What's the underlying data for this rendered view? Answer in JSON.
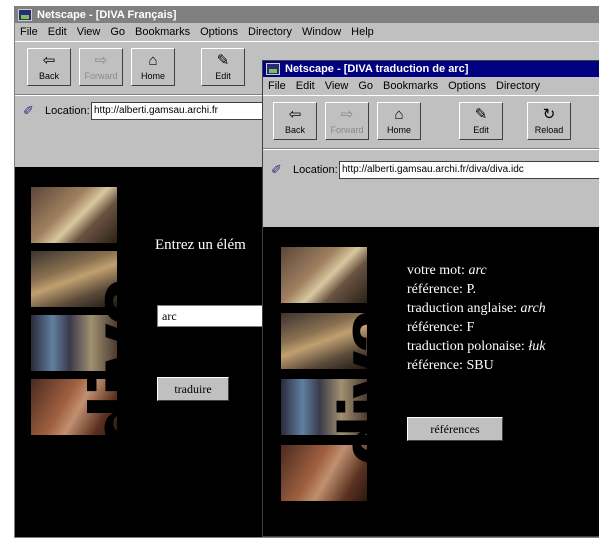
{
  "back_window": {
    "title": "Netscape - [DIVA Français]",
    "menu": [
      "File",
      "Edit",
      "View",
      "Go",
      "Bookmarks",
      "Options",
      "Directory",
      "Window",
      "Help"
    ],
    "toolbar": [
      {
        "label": "Back",
        "icon": "back-arrow-icon"
      },
      {
        "label": "Forward",
        "icon": "forward-arrow-icon"
      },
      {
        "label": "Home",
        "icon": "home-icon"
      },
      {
        "label": "Edit",
        "icon": "pencil-icon"
      }
    ],
    "location_label": "Location:",
    "location_url": "http://alberti.gamsau.archi.fr",
    "prompt": "Entrez un élém",
    "input_value": "arc",
    "button_label": "traduire"
  },
  "front_window": {
    "title": "Netscape - [DIVA traduction de arc]",
    "menu": [
      "File",
      "Edit",
      "View",
      "Go",
      "Bookmarks",
      "Options",
      "Directory"
    ],
    "toolbar": [
      {
        "label": "Back",
        "icon": "back-arrow-icon"
      },
      {
        "label": "Forward",
        "icon": "forward-arrow-icon"
      },
      {
        "label": "Home",
        "icon": "home-icon"
      },
      {
        "label": "Edit",
        "icon": "pencil-icon"
      },
      {
        "label": "Reload",
        "icon": "reload-icon"
      }
    ],
    "location_label": "Location:",
    "location_url": "http://alberti.gamsau.archi.fr/diva/diva.idc",
    "lines": [
      {
        "label": "votre mot: ",
        "value": "arc"
      },
      {
        "label": "référence: P.",
        "value": ""
      },
      {
        "label": "traduction anglaise: ",
        "value": "arch"
      },
      {
        "label": "référence: F",
        "value": ""
      },
      {
        "label": "traduction polonaise: ",
        "value": "łuk"
      },
      {
        "label": "référence: SBU",
        "value": ""
      }
    ],
    "button_label": "références"
  },
  "logo_text": "diva",
  "colors": {
    "titlebar_active": "#000080",
    "titlebar_inactive": "#808080",
    "page_bg": "#000000"
  }
}
